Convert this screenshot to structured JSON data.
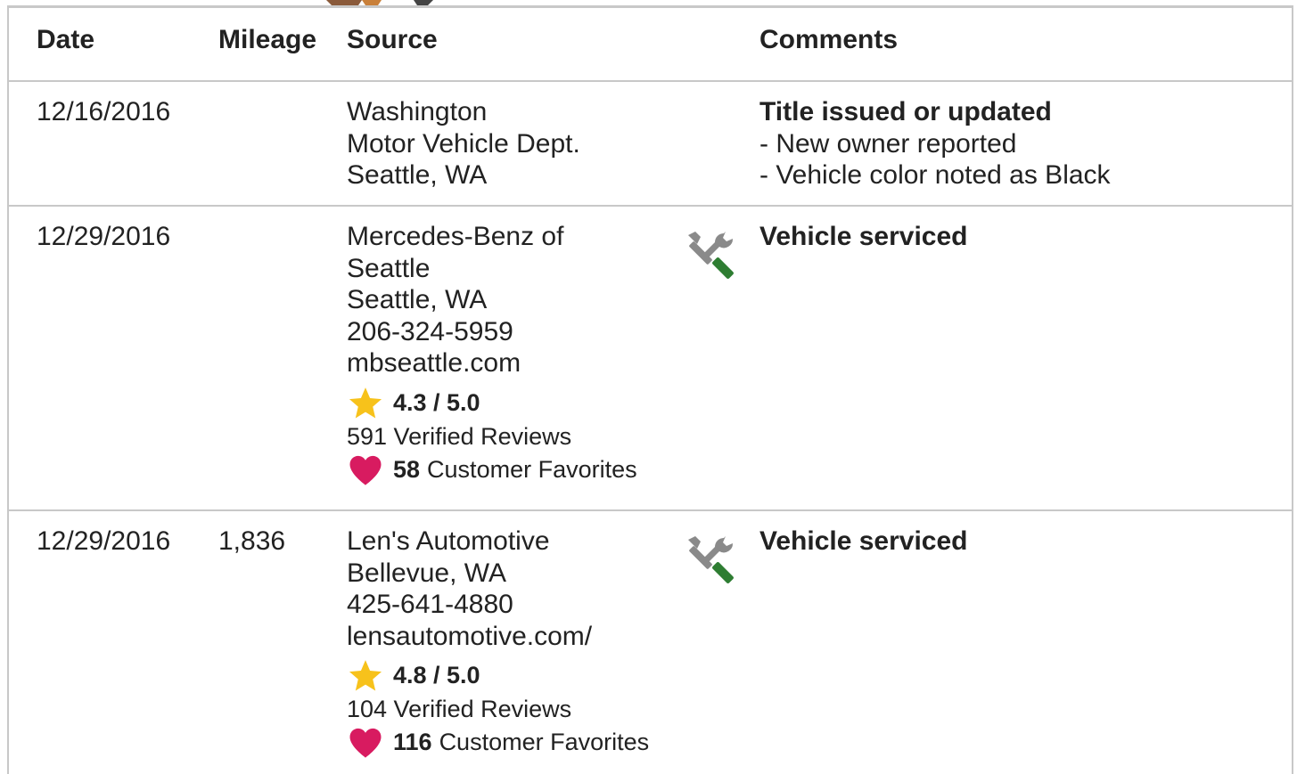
{
  "table": {
    "headers": {
      "date": "Date",
      "mileage": "Mileage",
      "source": "Source",
      "comments": "Comments"
    },
    "rows": [
      {
        "date": "12/16/2016",
        "mileage": "",
        "source_lines": [
          "Washington",
          "Motor Vehicle Dept.",
          "Seattle, WA"
        ],
        "has_service_icon": false,
        "comment_title": "Title issued or updated",
        "comment_items": [
          "- New owner reported",
          "- Vehicle color noted as Black"
        ]
      },
      {
        "date": "12/29/2016",
        "mileage": "",
        "source_lines": [
          "Mercedes-Benz of",
          "Seattle",
          "Seattle, WA",
          "206-324-5959",
          "mbseattle.com"
        ],
        "rating": "4.3 / 5.0",
        "reviews": "591 Verified Reviews",
        "favorites_count": "58",
        "favorites_label": "Customer Favorites",
        "has_service_icon": true,
        "comment_title": "Vehicle serviced"
      },
      {
        "date": "12/29/2016",
        "mileage": "1,836",
        "source_lines": [
          "Len's Automotive",
          "Bellevue, WA",
          "425-641-4880",
          "lensautomotive.com/"
        ],
        "rating": "4.8 / 5.0",
        "reviews": "104 Verified Reviews",
        "favorites_count": "116",
        "favorites_label": "Customer Favorites",
        "has_service_icon": true,
        "comment_title": "Vehicle serviced"
      }
    ]
  },
  "icons": {
    "rating": "star-icon",
    "favorites": "heart-icon",
    "service": "service-tools-icon"
  },
  "colors": {
    "star": "#f7c21b",
    "heart": "#d81b60",
    "tool_gray": "#8a8a8a",
    "tool_green": "#2e7d32",
    "border": "#c8c8c8",
    "text": "#222222"
  }
}
